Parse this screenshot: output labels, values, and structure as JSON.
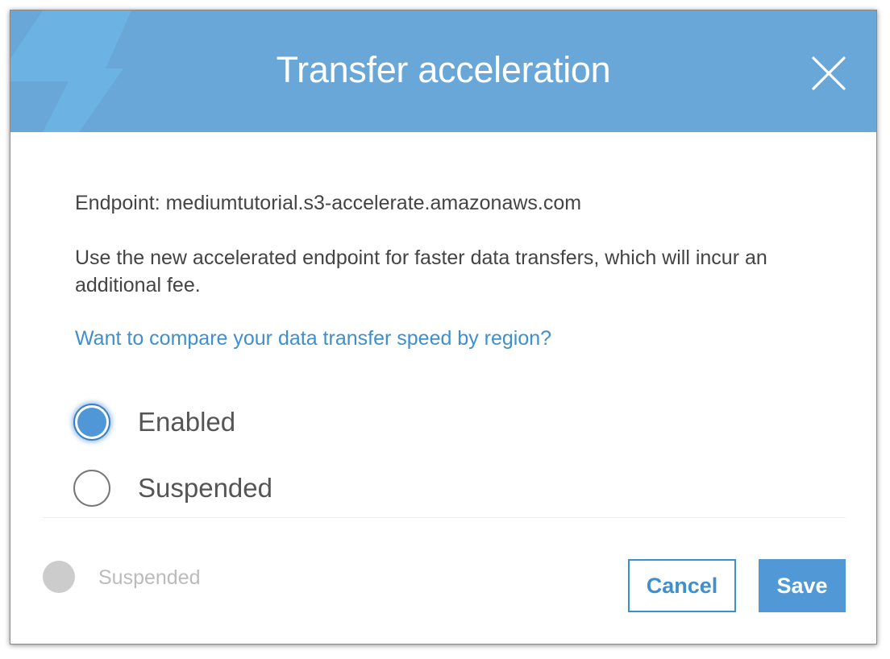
{
  "dialog": {
    "title": "Transfer acceleration",
    "close_icon": "close-icon",
    "header_icon": "lightning-bolt-icon",
    "header_color": "#68a7d8"
  },
  "content": {
    "endpoint": "Endpoint: mediumtutorial.s3-accelerate.amazonaws.com",
    "description": "Use the new accelerated endpoint for faster data transfers, which will incur an additional fee.",
    "compare_link": "Want to compare your data transfer speed by region?"
  },
  "options": {
    "selected": "Enabled",
    "items": [
      {
        "label": "Enabled",
        "checked": true
      },
      {
        "label": "Suspended",
        "checked": false
      }
    ]
  },
  "footer": {
    "status_text": "Suspended",
    "cancel_label": "Cancel",
    "save_label": "Save"
  },
  "colors": {
    "accent": "#3f8fcc",
    "primary_button": "#5199d6",
    "status_dot": "#cccccc"
  }
}
